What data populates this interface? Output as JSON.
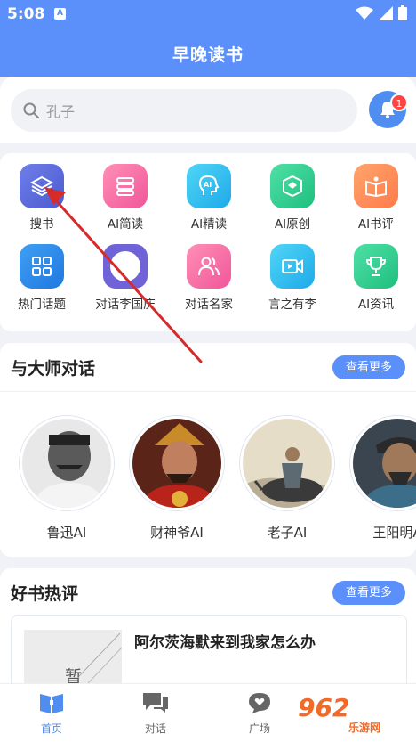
{
  "status_bar": {
    "time": "5:08",
    "indicator": "A"
  },
  "header": {
    "title": "早晚读书"
  },
  "search": {
    "placeholder": "孔子",
    "badge_count": "1"
  },
  "grid": {
    "items": [
      {
        "label": "搜书",
        "icon": "layers-icon"
      },
      {
        "label": "AI简读",
        "icon": "stack-icon"
      },
      {
        "label": "AI精读",
        "icon": "ai-head-icon"
      },
      {
        "label": "AI原创",
        "icon": "cube-icon"
      },
      {
        "label": "AI书评",
        "icon": "open-book-icon"
      },
      {
        "label": "热门话题",
        "icon": "grid-icon"
      },
      {
        "label": "对话李国庆",
        "icon": "avatar-icon"
      },
      {
        "label": "对话名家",
        "icon": "people-icon"
      },
      {
        "label": "言之有李",
        "icon": "video-icon"
      },
      {
        "label": "AI资讯",
        "icon": "trophy-icon"
      }
    ]
  },
  "masters": {
    "title": "与大师对话",
    "more_label": "查看更多",
    "items": [
      {
        "name": "鲁迅AI"
      },
      {
        "name": "财神爷AI"
      },
      {
        "name": "老子AI"
      },
      {
        "name": "王阳明A"
      }
    ]
  },
  "reviews": {
    "title": "好书热评",
    "more_label": "查看更多",
    "items": [
      {
        "cover_text": "暂",
        "title": "阿尔茨海默来到我家怎么办"
      }
    ]
  },
  "tabbar": {
    "tabs": [
      {
        "label": "首页",
        "active": true
      },
      {
        "label": "对话",
        "active": false
      },
      {
        "label": "广场",
        "active": false
      }
    ]
  },
  "watermark": {
    "text": "962",
    "sub": "乐游网"
  },
  "colors": {
    "primary": "#5b8ff9",
    "badge": "#ff4444",
    "annotation_arrow": "#d62b2b"
  }
}
